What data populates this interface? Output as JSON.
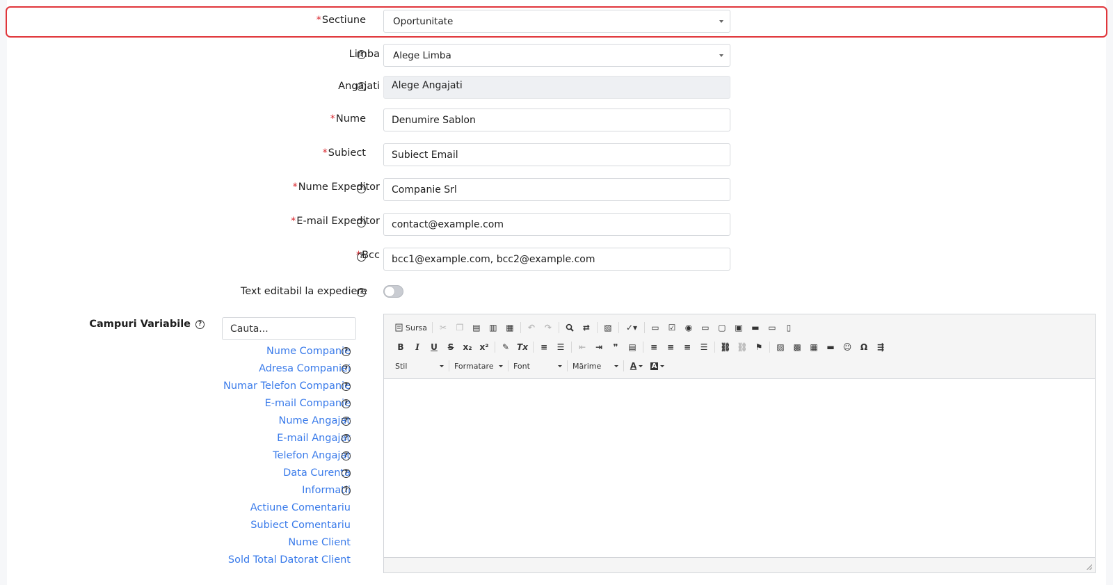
{
  "form": {
    "sectiune": {
      "label": "Sectiune",
      "value": "Oportunitate"
    },
    "limba": {
      "label": "Limba",
      "value": "Alege Limba"
    },
    "angajati": {
      "label": "Angajati",
      "value": "Alege Angajati"
    },
    "nume": {
      "label": "Nume",
      "value": "Denumire Sablon"
    },
    "subiect": {
      "label": "Subiect",
      "value": "Subiect Email"
    },
    "nume_expeditor": {
      "label": "Nume Expeditor",
      "value": "Companie Srl"
    },
    "email_expeditor": {
      "label": "E-mail Expeditor",
      "value": "contact@example.com"
    },
    "bcc": {
      "label": "Bcc",
      "value": "bcc1@example.com, bcc2@example.com"
    },
    "text_editabil": {
      "label": "Text editabil la expediere",
      "enabled": false
    },
    "required_marker": "*",
    "help_icon_glyph": "?"
  },
  "variables": {
    "label": "Campuri Variabile",
    "search_placeholder": "Cauta...",
    "items": [
      "Nume Companie",
      "Adresa Companiei",
      "Numar Telefon Companie",
      "E-mail Companie",
      "Nume Angajat",
      "E-mail Angajat",
      "Telefon Angajat",
      "Data Curenta",
      "Informatii",
      "Actiune Comentariu",
      "Subiect Comentariu",
      "Nume Client",
      "Sold Total Datorat Client"
    ]
  },
  "editor": {
    "source_label": "Sursa",
    "style_combo": "Stil",
    "format_combo": "Formatare",
    "font_combo": "Font",
    "size_combo": "Mărime",
    "bold": "B",
    "italic": "I",
    "underline": "U",
    "strike": "S",
    "subscript": "x₂",
    "superscript": "x²",
    "remove_format": "Tx",
    "blockquote": "❞",
    "special_char": "Ω",
    "text_color": "A",
    "bg_color": "A"
  },
  "colors": {
    "highlight": "#e0353a",
    "link": "#3a7bea",
    "required": "#d9272e"
  }
}
